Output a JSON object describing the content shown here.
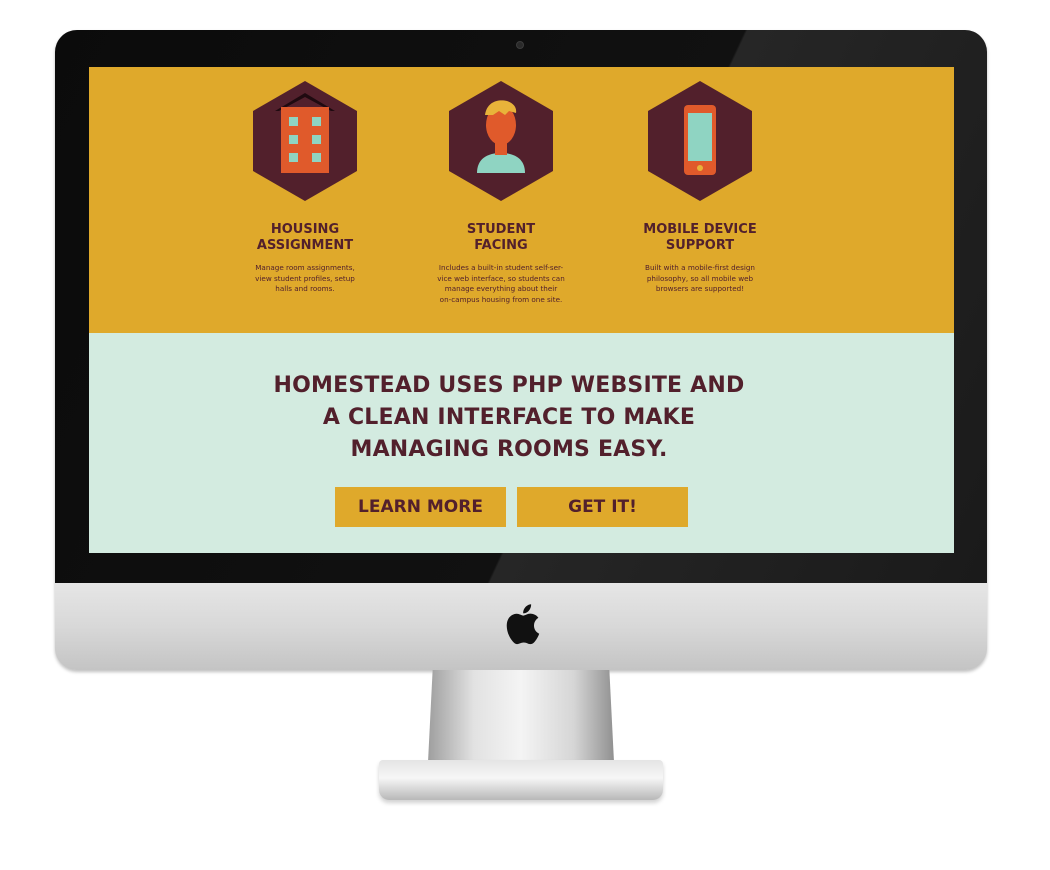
{
  "features": [
    {
      "icon": "building-icon",
      "title": "HOUSING\nASSIGNMENT",
      "description": "Manage room assignments,\nview student profiles, setup\nhalls and rooms."
    },
    {
      "icon": "student-icon",
      "title": "STUDENT\nFACING",
      "description": "Includes a built-in student self-ser-\nvice web interface, so students can\nmanage everything about their\non-campus housing from one site."
    },
    {
      "icon": "mobile-phone-icon",
      "title": "MOBILE DEVICE\nSUPPORT",
      "description": "Built with a mobile-first design\nphilosophy, so all mobile web\nbrowsers are supported!"
    }
  ],
  "cta": {
    "headline": "HOMESTEAD USES PHP WEBSITE AND\nA CLEAN INTERFACE TO MAKE\nMANAGING ROOMS EASY.",
    "learn_more_label": "LEARN MORE",
    "get_it_label": "GET IT!"
  },
  "colors": {
    "mustard": "#dfa92b",
    "maroon": "#52202c",
    "mint": "#d3ebe0",
    "orange": "#e05a2b",
    "teal": "#8fd4c2"
  }
}
